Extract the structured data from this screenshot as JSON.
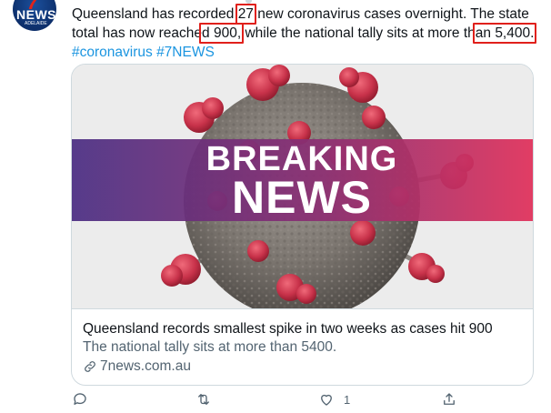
{
  "account": {
    "avatar_icon": "7news-logo",
    "logo_text": "NEWS",
    "logo_sub": "ADELAIDE"
  },
  "tweet": {
    "text_a": "Queensland has recorded ",
    "num_cases": "27",
    "text_b": " new coronavirus cases overnight. The state total has now reache",
    "num_total": "d 900,",
    "text_c": " while the national tally sits at more th",
    "num_national": "an 5,400.",
    "hashtag_1": "#coronavirus",
    "hashtag_2": "#7NEWS"
  },
  "card": {
    "image_line1": "BREAKING",
    "image_line2": "NEWS",
    "title": "Queensland records smallest spike in two weeks as cases hit 900",
    "description": "The national tally sits at more than 5400.",
    "domain": "7news.com.au",
    "link_icon": "link-icon"
  },
  "actions": {
    "reply_icon": "reply-icon",
    "retweet_icon": "retweet-icon",
    "like_icon": "heart-icon",
    "like_count": "1",
    "share_icon": "share-icon"
  },
  "colors": {
    "highlight": "#e0201b",
    "hashtag": "#1b95e0",
    "banner_left": "#4b2e83",
    "banner_right": "#e0305a"
  }
}
